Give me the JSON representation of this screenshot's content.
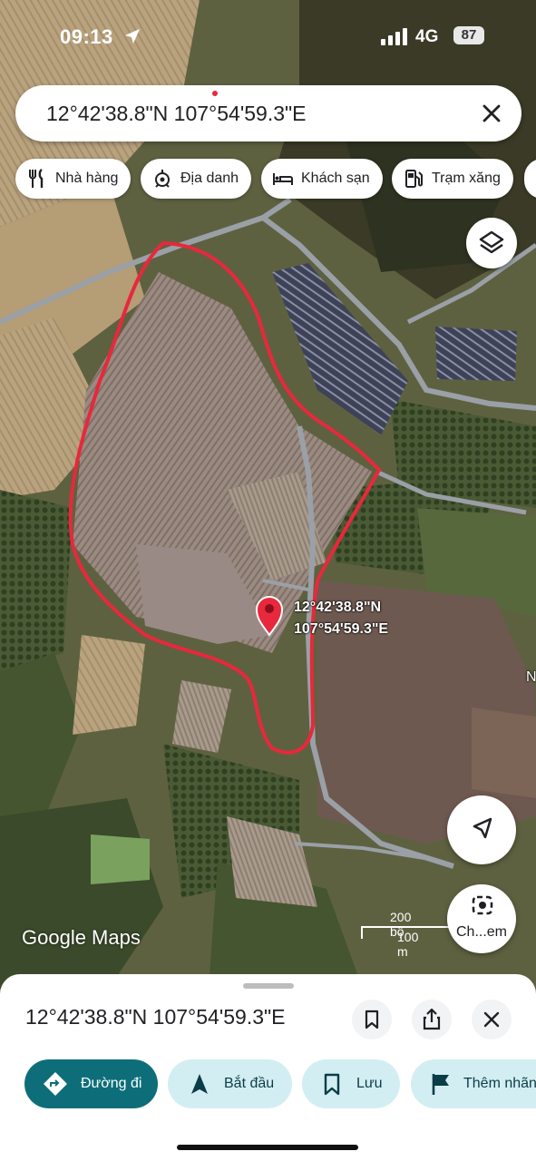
{
  "status_bar": {
    "time": "09:13",
    "network": "4G",
    "battery": "87"
  },
  "search": {
    "query": "12°42'38.8\"N 107°54'59.3\"E"
  },
  "chips": [
    {
      "label": "Nhà hàng",
      "icon": "restaurant-icon"
    },
    {
      "label": "Địa danh",
      "icon": "landmark-icon"
    },
    {
      "label": "Khách sạn",
      "icon": "hotel-icon"
    },
    {
      "label": "Trạm xăng",
      "icon": "gas-station-icon"
    }
  ],
  "map": {
    "pin_label_line1": "12°42'38.8\"N",
    "pin_label_line2": "107°54'59.3\"E",
    "logo": "Google Maps",
    "scale_top": "200 bộ",
    "scale_bottom": "100 m",
    "edge_letter": "N",
    "camera_button_label": "Ch...em",
    "boundary_color": "#e8283c"
  },
  "sheet": {
    "title": "12°42'38.8\"N 107°54'59.3\"E",
    "actions": [
      {
        "label": "Đường đi",
        "icon": "directions-icon",
        "primary": true
      },
      {
        "label": "Bắt đầu",
        "icon": "navigation-arrow-icon",
        "primary": false
      },
      {
        "label": "Lưu",
        "icon": "bookmark-icon",
        "primary": false
      },
      {
        "label": "Thêm nhãn",
        "icon": "flag-icon",
        "primary": false
      }
    ]
  },
  "colors": {
    "accent": "#0d6e7a",
    "action_bg": "#d3eef3",
    "pin": "#e8283c"
  }
}
